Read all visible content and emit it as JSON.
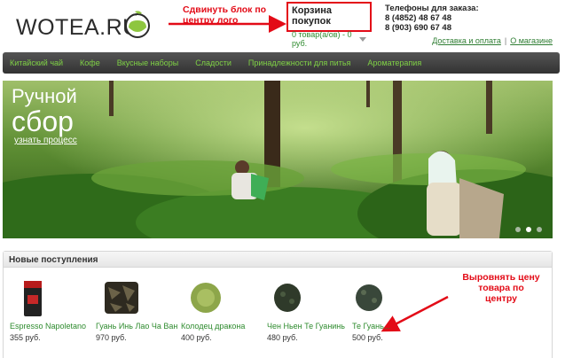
{
  "header": {
    "logo_prefix": "WO",
    "logo_main": "TEA.RU",
    "annotation_logo": "Сдвинуть блок по центру лого",
    "cart": {
      "title": "Корзина покупок",
      "summary": "0 товар(а/ов) - 0 руб."
    },
    "phones": {
      "title": "Телефоны для заказа:",
      "numbers": [
        "8 (4852) 48 67 48",
        "8 (903) 690 67 48"
      ]
    },
    "links": [
      "Доставка и оплата",
      "О магазине"
    ],
    "link_separator": "|"
  },
  "nav": {
    "items": [
      "Китайский чай",
      "Кофе",
      "Вкусные наборы",
      "Сладости",
      "Принадлежности для питья",
      "Ароматерапия"
    ]
  },
  "banner": {
    "title_line1": "Ручной",
    "title_line2": "сбор",
    "link": "узнать процесс",
    "dots_count": 3,
    "active_dot": 2
  },
  "arrivals": {
    "heading": "Новые поступления",
    "products": [
      {
        "name": "Espresso Napoletano",
        "price": "355 руб."
      },
      {
        "name": "Гуань Инь Лао Ча Ван",
        "price": "970 руб."
      },
      {
        "name": "Колодец дракона",
        "price": "400 руб."
      },
      {
        "name": "Чен Ньен Те Гуанинь",
        "price": "480 руб."
      },
      {
        "name": "Те Гуань...",
        "price": "500 руб."
      }
    ],
    "annotation_price": "Выровнять цену товара по центру"
  },
  "colors": {
    "accent_green": "#7fd145",
    "link_green": "#2e8b2e",
    "annotation_red": "#e30b17",
    "nav_bg": "#3f3f3f"
  }
}
